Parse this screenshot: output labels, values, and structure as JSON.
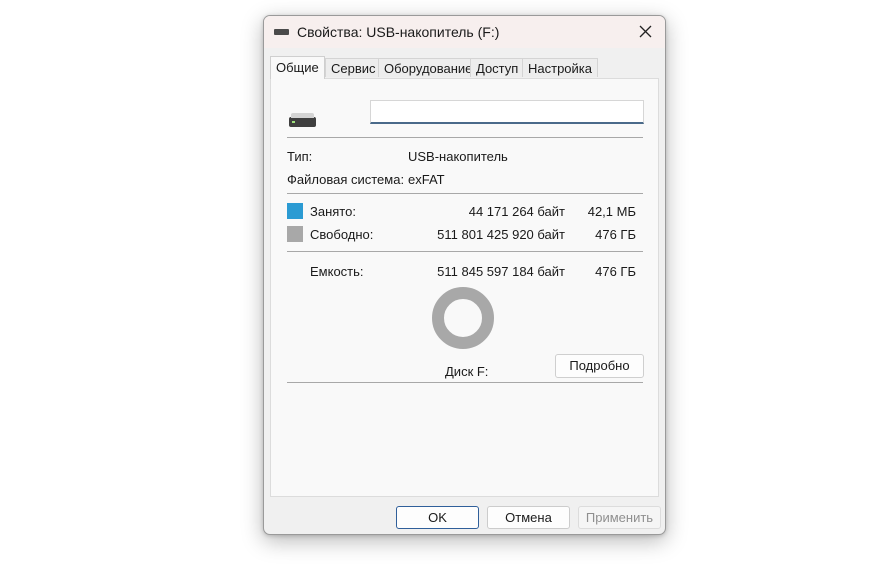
{
  "window": {
    "title": "Свойства: USB-накопитель (F:)",
    "icon": "usb-drive-icon",
    "close_icon": "close-icon"
  },
  "tabs": [
    {
      "label": "Общие",
      "active": true
    },
    {
      "label": "Сервис",
      "active": false
    },
    {
      "label": "Оборудование",
      "active": false
    },
    {
      "label": "Доступ",
      "active": false
    },
    {
      "label": "Настройка",
      "active": false
    }
  ],
  "general": {
    "drive_icon": "usb-drive-icon",
    "name_value": "",
    "type_label": "Тип:",
    "type_value": "USB-накопитель",
    "fs_label": "Файловая система:",
    "fs_value": "exFAT",
    "used_label": "Занято:",
    "used_bytes": "44 171 264 байт",
    "used_short": "42,1 МБ",
    "used_color": "#2b9bd3",
    "free_label": "Свободно:",
    "free_bytes": "511 801 425 920 байт",
    "free_short": "476 ГБ",
    "free_color": "#a8a8a8",
    "capacity_label": "Емкость:",
    "capacity_bytes": "511 845 597 184 байт",
    "capacity_short": "476 ГБ",
    "used_fraction": 8.63e-05,
    "disk_label": "Диск F:",
    "details_label": "Подробно"
  },
  "buttons": {
    "ok": "OK",
    "cancel": "Отмена",
    "apply": "Применить"
  }
}
